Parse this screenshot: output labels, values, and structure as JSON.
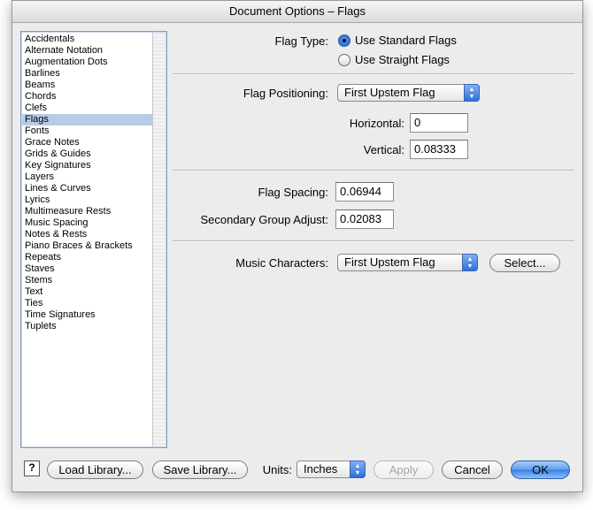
{
  "window": {
    "title": "Document Options – Flags"
  },
  "sidebar": {
    "items": [
      {
        "label": "Accidentals",
        "selected": false
      },
      {
        "label": "Alternate Notation",
        "selected": false
      },
      {
        "label": "Augmentation Dots",
        "selected": false
      },
      {
        "label": "Barlines",
        "selected": false
      },
      {
        "label": "Beams",
        "selected": false
      },
      {
        "label": "Chords",
        "selected": false
      },
      {
        "label": "Clefs",
        "selected": false
      },
      {
        "label": "Flags",
        "selected": true
      },
      {
        "label": "Fonts",
        "selected": false
      },
      {
        "label": "Grace Notes",
        "selected": false
      },
      {
        "label": "Grids & Guides",
        "selected": false
      },
      {
        "label": "Key Signatures",
        "selected": false
      },
      {
        "label": "Layers",
        "selected": false
      },
      {
        "label": "Lines & Curves",
        "selected": false
      },
      {
        "label": "Lyrics",
        "selected": false
      },
      {
        "label": "Multimeasure Rests",
        "selected": false
      },
      {
        "label": "Music Spacing",
        "selected": false
      },
      {
        "label": "Notes & Rests",
        "selected": false
      },
      {
        "label": "Piano Braces & Brackets",
        "selected": false
      },
      {
        "label": "Repeats",
        "selected": false
      },
      {
        "label": "Staves",
        "selected": false
      },
      {
        "label": "Stems",
        "selected": false
      },
      {
        "label": "Text",
        "selected": false
      },
      {
        "label": "Ties",
        "selected": false
      },
      {
        "label": "Time Signatures",
        "selected": false
      },
      {
        "label": "Tuplets",
        "selected": false
      }
    ]
  },
  "flag_type": {
    "label": "Flag Type:",
    "options": [
      {
        "label": "Use Standard Flags",
        "checked": true
      },
      {
        "label": "Use Straight Flags",
        "checked": false
      }
    ]
  },
  "flag_positioning": {
    "label": "Flag Positioning:",
    "selected": "First Upstem Flag",
    "horizontal_label": "Horizontal:",
    "horizontal_value": "0",
    "vertical_label": "Vertical:",
    "vertical_value": "0.08333"
  },
  "spacing": {
    "flag_spacing_label": "Flag Spacing:",
    "flag_spacing_value": "0.06944",
    "secondary_label": "Secondary Group Adjust:",
    "secondary_value": "0.02083"
  },
  "music_characters": {
    "label": "Music Characters:",
    "selected": "First Upstem Flag",
    "select_button": "Select..."
  },
  "footer": {
    "help": "?",
    "load_library": "Load Library...",
    "save_library": "Save Library...",
    "units_label": "Units:",
    "units_value": "Inches",
    "apply": "Apply",
    "cancel": "Cancel",
    "ok": "OK"
  },
  "colors": {
    "accent": "#3a7fe0",
    "selection": "#b8cbe7"
  }
}
